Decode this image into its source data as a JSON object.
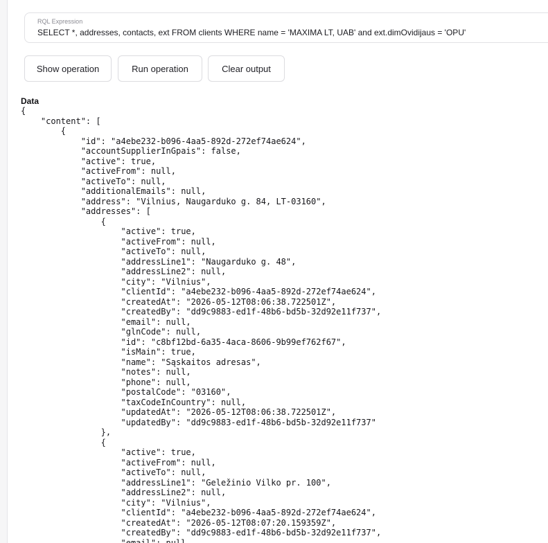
{
  "rql": {
    "label": "RQL Expression",
    "value": "SELECT *, addresses, contacts, ext FROM clients WHERE name = 'MAXIMA LT, UAB' and ext.dimOvidijaus = 'OPU'"
  },
  "buttons": {
    "show_operation": "Show operation",
    "run_operation": "Run operation",
    "clear_output": "Clear output"
  },
  "output": {
    "heading": "Data",
    "json_text": "{\n    \"content\": [\n        {\n            \"id\": \"a4ebe232-b096-4aa5-892d-272ef74ae624\",\n            \"accountSupplierInGpais\": false,\n            \"active\": true,\n            \"activeFrom\": null,\n            \"activeTo\": null,\n            \"additionalEmails\": null,\n            \"address\": \"Vilnius, Naugarduko g. 84, LT-03160\",\n            \"addresses\": [\n                {\n                    \"active\": true,\n                    \"activeFrom\": null,\n                    \"activeTo\": null,\n                    \"addressLine1\": \"Naugarduko g. 48\",\n                    \"addressLine2\": null,\n                    \"city\": \"Vilnius\",\n                    \"clientId\": \"a4ebe232-b096-4aa5-892d-272ef74ae624\",\n                    \"createdAt\": \"2026-05-12T08:06:38.722501Z\",\n                    \"createdBy\": \"dd9c9883-ed1f-48b6-bd5b-32d92e11f737\",\n                    \"email\": null,\n                    \"glnCode\": null,\n                    \"id\": \"c8bf12bd-6a35-4aca-8606-9b99ef762f67\",\n                    \"isMain\": true,\n                    \"name\": \"Sąskaitos adresas\",\n                    \"notes\": null,\n                    \"phone\": null,\n                    \"postalCode\": \"03160\",\n                    \"taxCodeInCountry\": null,\n                    \"updatedAt\": \"2026-05-12T08:06:38.722501Z\",\n                    \"updatedBy\": \"dd9c9883-ed1f-48b6-bd5b-32d92e11f737\"\n                },\n                {\n                    \"active\": true,\n                    \"activeFrom\": null,\n                    \"activeTo\": null,\n                    \"addressLine1\": \"Geležinio Vilko pr. 100\",\n                    \"addressLine2\": null,\n                    \"city\": \"Vilnius\",\n                    \"clientId\": \"a4ebe232-b096-4aa5-892d-272ef74ae624\",\n                    \"createdAt\": \"2026-05-12T08:07:20.159359Z\",\n                    \"createdBy\": \"dd9c9883-ed1f-48b6-bd5b-32d92e11f737\",\n                    \"email\": null"
  }
}
